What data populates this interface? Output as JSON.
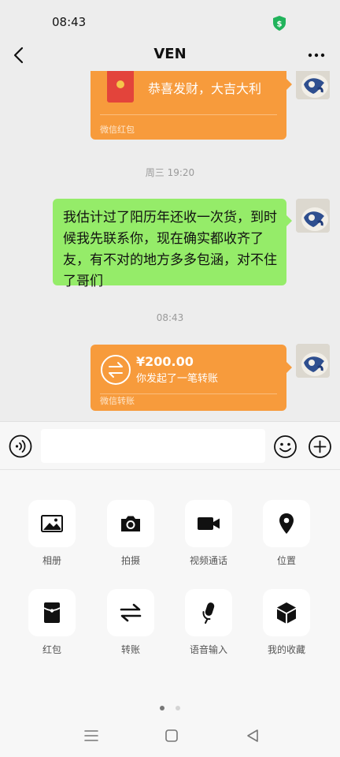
{
  "status_bar": {
    "time": "08:43",
    "shield_icon": "shield-dollar-icon",
    "shield_color": "#21b35b"
  },
  "nav": {
    "title": "VEN",
    "back_icon": "chevron-left-icon",
    "more_icon": "more-dots-icon"
  },
  "messages": [
    {
      "kind": "red_packet",
      "text": "恭喜发财，大吉大利",
      "footer": "微信红包"
    },
    {
      "kind": "time",
      "text": "周三 19:20"
    },
    {
      "kind": "text",
      "text": "我估计过了阳历年还收一次货，到时候我先联系你，现在确实都收齐了友，有不对的地方多多包涵，对不住了哥们"
    },
    {
      "kind": "time",
      "text": "08:43"
    },
    {
      "kind": "transfer",
      "amount": "¥200.00",
      "description": "你发起了一笔转账",
      "footer": "微信转账"
    }
  ],
  "input_bar": {
    "placeholder": "",
    "voice_icon": "voice-icon",
    "emoji_icon": "emoji-icon",
    "plus_icon": "plus-icon"
  },
  "tools": [
    {
      "label": "相册",
      "icon": "image-icon"
    },
    {
      "label": "拍摄",
      "icon": "camera-icon"
    },
    {
      "label": "视频通话",
      "icon": "video-call-icon"
    },
    {
      "label": "位置",
      "icon": "location-icon"
    },
    {
      "label": "红包",
      "icon": "red-packet-icon"
    },
    {
      "label": "转账",
      "icon": "transfer-icon"
    },
    {
      "label": "语音输入",
      "icon": "microphone-icon"
    },
    {
      "label": "我的收藏",
      "icon": "favorites-cube-icon"
    }
  ],
  "pager": {
    "pages": 2,
    "current": 1
  },
  "colors": {
    "background": "#ededed",
    "own_text_bubble": "#95ec69",
    "payment_bubble": "#f79b3c",
    "panel": "#f7f7f7"
  }
}
